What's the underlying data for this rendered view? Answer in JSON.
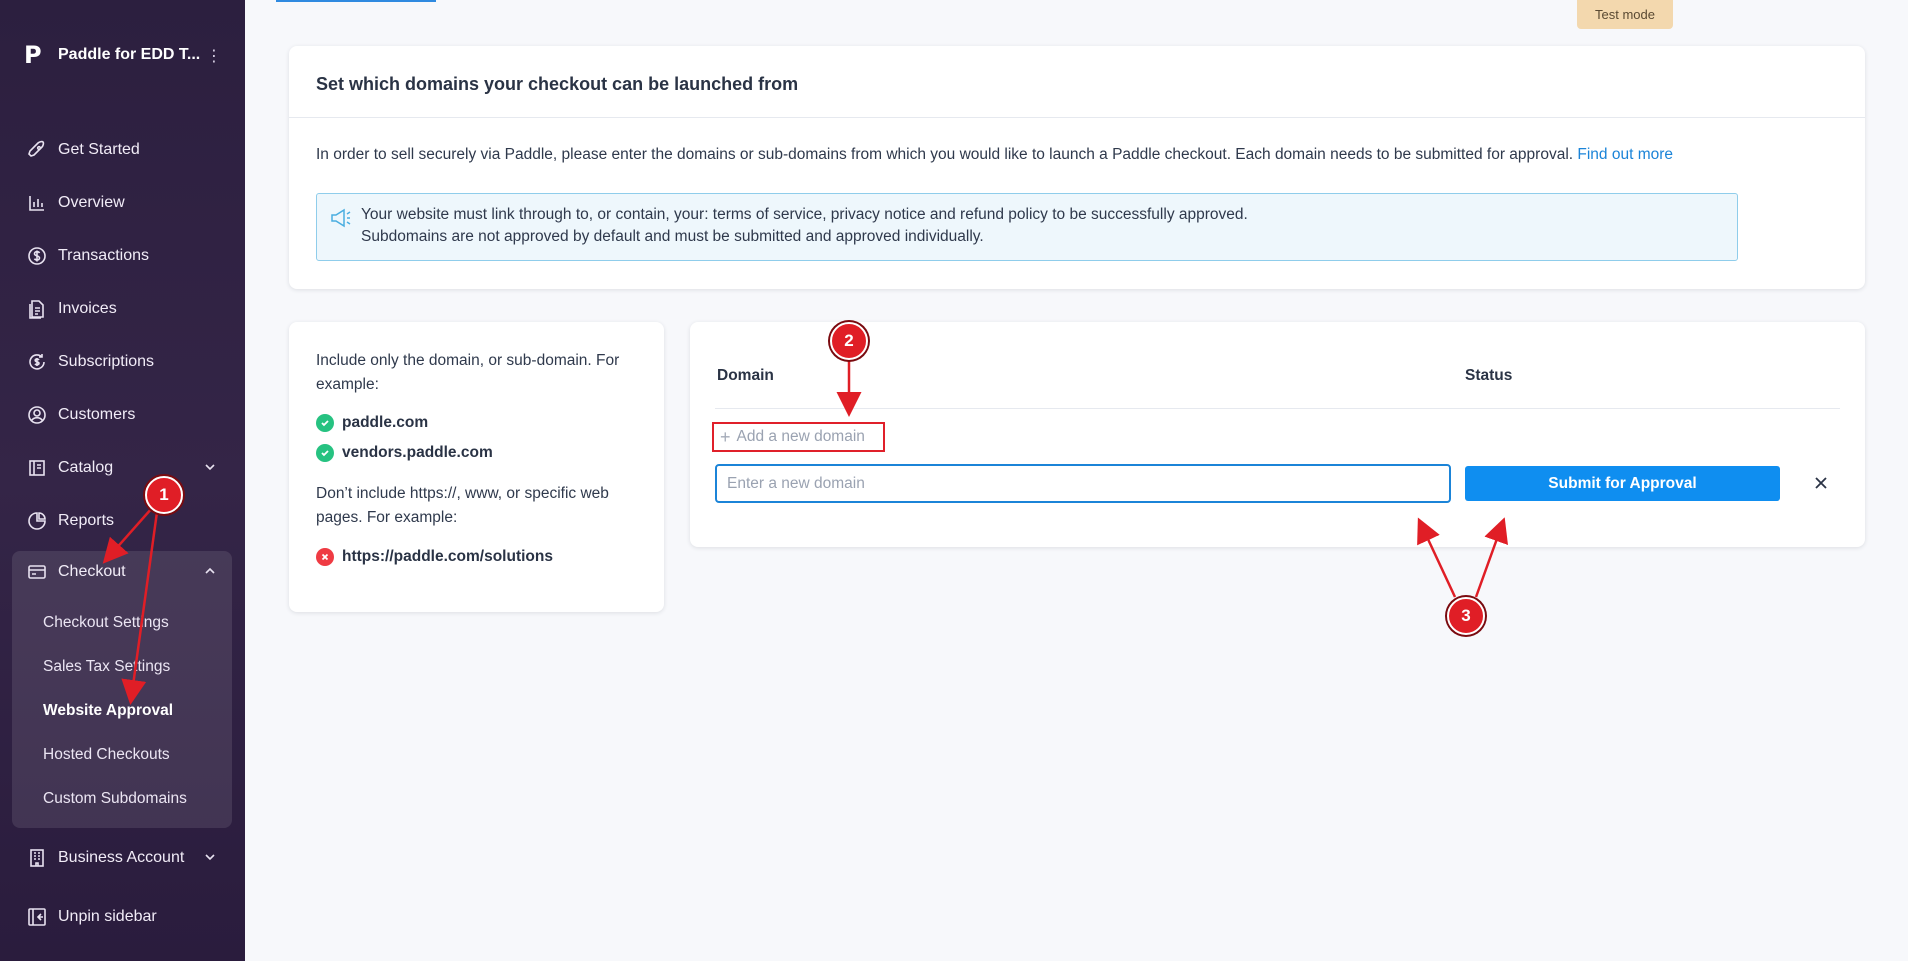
{
  "sidebar": {
    "brand_name": "Paddle for EDD T...",
    "brand_icon": "paddle-logo-icon",
    "items": [
      {
        "label": "Get Started",
        "icon": "rocket-icon"
      },
      {
        "label": "Overview",
        "icon": "bar-chart-icon"
      },
      {
        "label": "Transactions",
        "icon": "dollar-circle-icon"
      },
      {
        "label": "Invoices",
        "icon": "invoice-icon"
      },
      {
        "label": "Subscriptions",
        "icon": "refresh-dollar-icon"
      },
      {
        "label": "Customers",
        "icon": "user-circle-icon"
      },
      {
        "label": "Catalog",
        "icon": "book-icon"
      },
      {
        "label": "Reports",
        "icon": "pie-chart-icon"
      },
      {
        "label": "Checkout",
        "icon": "credit-card-icon"
      },
      {
        "label": "Business Account",
        "icon": "building-icon"
      },
      {
        "label": "Unpin sidebar",
        "icon": "unpin-icon"
      }
    ],
    "checkout_sub": [
      {
        "label": "Checkout Settings"
      },
      {
        "label": "Sales Tax Settings"
      },
      {
        "label": "Website Approval"
      },
      {
        "label": "Hosted Checkouts"
      },
      {
        "label": "Custom Subdomains"
      }
    ]
  },
  "test_mode": "Test mode",
  "domains_card": {
    "title": "Set which domains your checkout can be launched from",
    "description": "In order to sell securely via Paddle, please enter the domains or sub-domains from which you would like to launch a Paddle checkout. Each domain needs to be submitted for approval.",
    "find_out_more": "Find out more",
    "notice_line1": "Your website must link through to, or contain, your: terms of service, privacy notice and refund policy to be successfully approved.",
    "notice_line2": "Subdomains are not approved by default and must be submitted and approved individually."
  },
  "help_card": {
    "include_text": "Include only the domain, or sub-domain. For example:",
    "good_examples": [
      "paddle.com",
      "vendors.paddle.com"
    ],
    "exclude_text": "Don’t include https://, www, or specific web pages. For example:",
    "bad_example": "https://paddle.com/solutions"
  },
  "domain_table": {
    "col_domain": "Domain",
    "col_status": "Status",
    "add_label": "Add a new domain",
    "input_placeholder": "Enter a new domain",
    "submit_label": "Submit for Approval"
  },
  "annotations": {
    "marker1": "1",
    "marker2": "2",
    "marker3": "3",
    "accent": "#e01e26"
  }
}
